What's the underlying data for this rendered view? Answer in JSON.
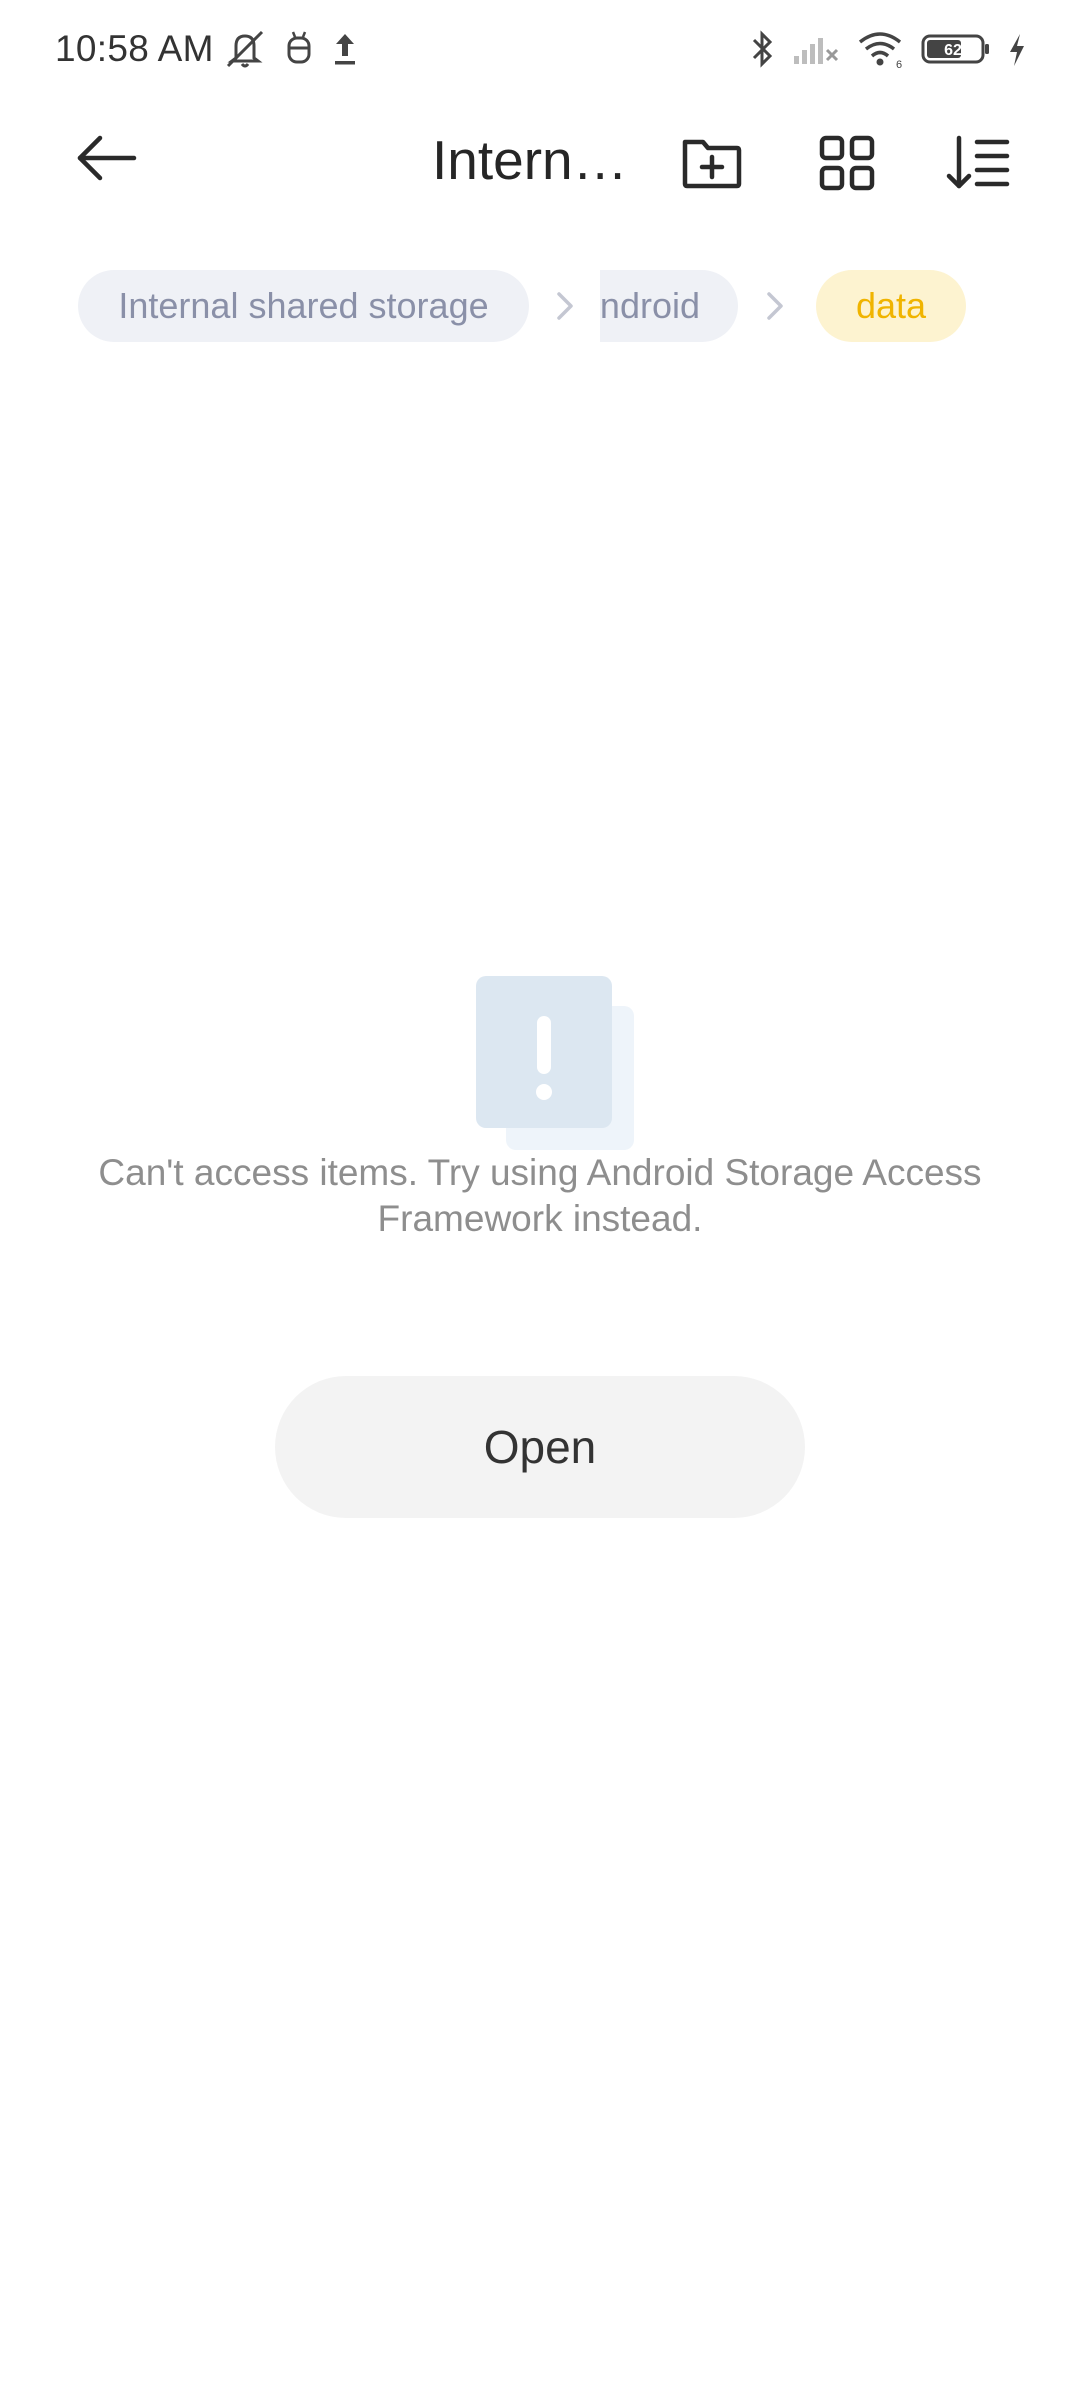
{
  "status_bar": {
    "time": "10:58 AM",
    "battery_level": "62",
    "left_icons": [
      "bell-off-icon",
      "android-debug-icon",
      "upload-icon"
    ],
    "right_icons": [
      "bluetooth-icon",
      "signal-icon",
      "wifi-icon",
      "battery-icon",
      "charging-icon"
    ]
  },
  "app_bar": {
    "title": "Interna…",
    "actions": [
      "new-folder-icon",
      "grid-view-icon",
      "sort-icon"
    ]
  },
  "breadcrumb": {
    "items": [
      {
        "label": "Internal shared storage"
      },
      {
        "label": "ndroid"
      },
      {
        "label": "data"
      }
    ]
  },
  "empty_state": {
    "message": "Can't access items. Try using Android Storage Access Framework instead.",
    "button_label": "Open"
  },
  "colors": {
    "active_crumb_bg": "#fdf3d0",
    "active_crumb_text": "#f0b400",
    "crumb_bg": "#eff1f6",
    "crumb_text": "#8a90a8"
  }
}
